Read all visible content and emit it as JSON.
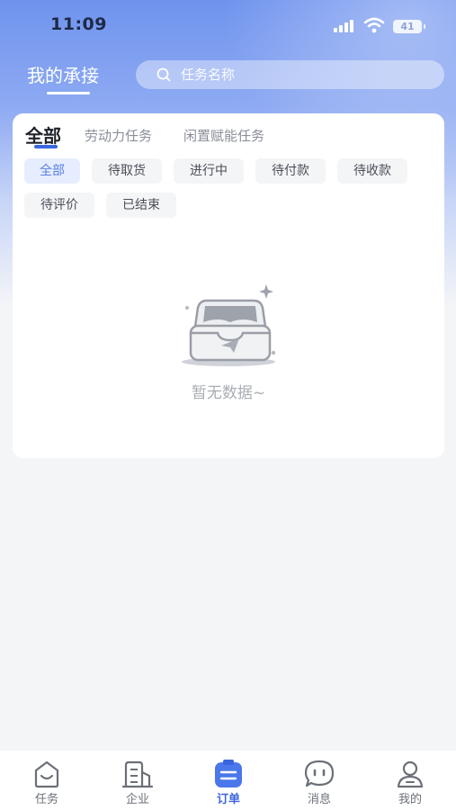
{
  "status_bar": {
    "time": "11:09",
    "battery": "41"
  },
  "header": {
    "title": "我的承接"
  },
  "search": {
    "placeholder": "任务名称"
  },
  "tabs": [
    {
      "label": "全部",
      "active": true
    },
    {
      "label": "劳动力任务",
      "active": false
    },
    {
      "label": "闲置赋能任务",
      "active": false
    }
  ],
  "filters": [
    {
      "label": "全部",
      "active": true
    },
    {
      "label": "待取货",
      "active": false
    },
    {
      "label": "进行中",
      "active": false
    },
    {
      "label": "待付款",
      "active": false
    },
    {
      "label": "待收款",
      "active": false
    },
    {
      "label": "待评价",
      "active": false
    },
    {
      "label": "已结束",
      "active": false
    }
  ],
  "empty": {
    "text": "暂无数据~",
    "icon": "empty-box-icon"
  },
  "tabbar": [
    {
      "label": "任务",
      "icon": "task-icon",
      "active": false
    },
    {
      "label": "企业",
      "icon": "building-icon",
      "active": false
    },
    {
      "label": "订单",
      "icon": "order-icon",
      "active": true
    },
    {
      "label": "消息",
      "icon": "message-icon",
      "active": false
    },
    {
      "label": "我的",
      "icon": "profile-icon",
      "active": false
    }
  ],
  "colors": {
    "accent": "#3b65de",
    "chip_active_bg": "#e6edff",
    "chip_active_text": "#5b7fe6"
  }
}
